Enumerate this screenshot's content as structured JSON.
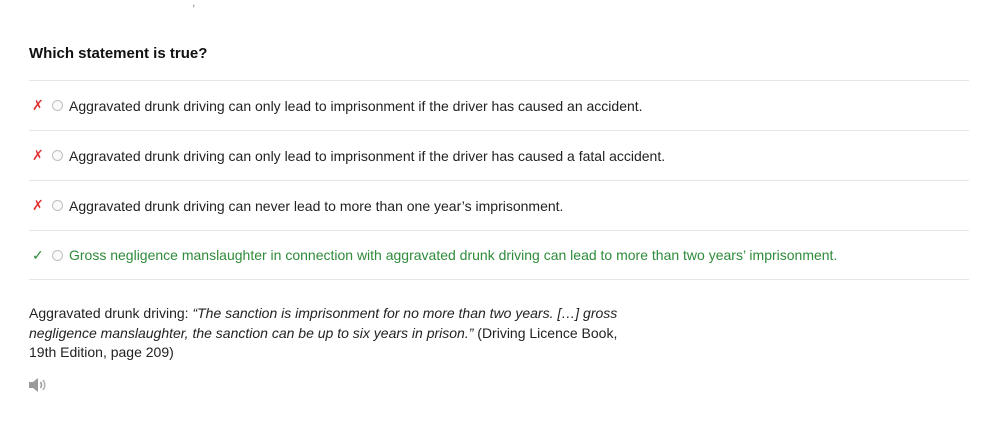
{
  "question": "Which statement is true?",
  "answers": [
    {
      "text": "Aggravated drunk driving can only lead to imprisonment if the driver has caused an accident.",
      "mark": "✗",
      "status": "wrong"
    },
    {
      "text": "Aggravated drunk driving can only lead to imprisonment if the driver has caused a fatal accident.",
      "mark": "✗",
      "status": "wrong"
    },
    {
      "text": "Aggravated drunk driving can never lead to more than one year’s imprisonment.",
      "mark": "✗",
      "status": "wrong"
    },
    {
      "text": "Gross negligence manslaughter in connection with aggravated drunk driving can lead to more than two years’ imprisonment.",
      "mark": "✓",
      "status": "correct"
    }
  ],
  "explanation": {
    "prefix": "Aggravated drunk driving: ",
    "quote": "“The sanction is imprisonment for no more than two years. […] gross negligence manslaughter, the sanction can be up to six years in prison.”",
    "source": " (Driving Licence Book, 19th Edition, page 209)"
  },
  "colors": {
    "wrong": "#e03131",
    "correct": "#2e8b3a",
    "divider": "#e6e6e6"
  },
  "icons": {
    "audio": "speaker-icon"
  }
}
